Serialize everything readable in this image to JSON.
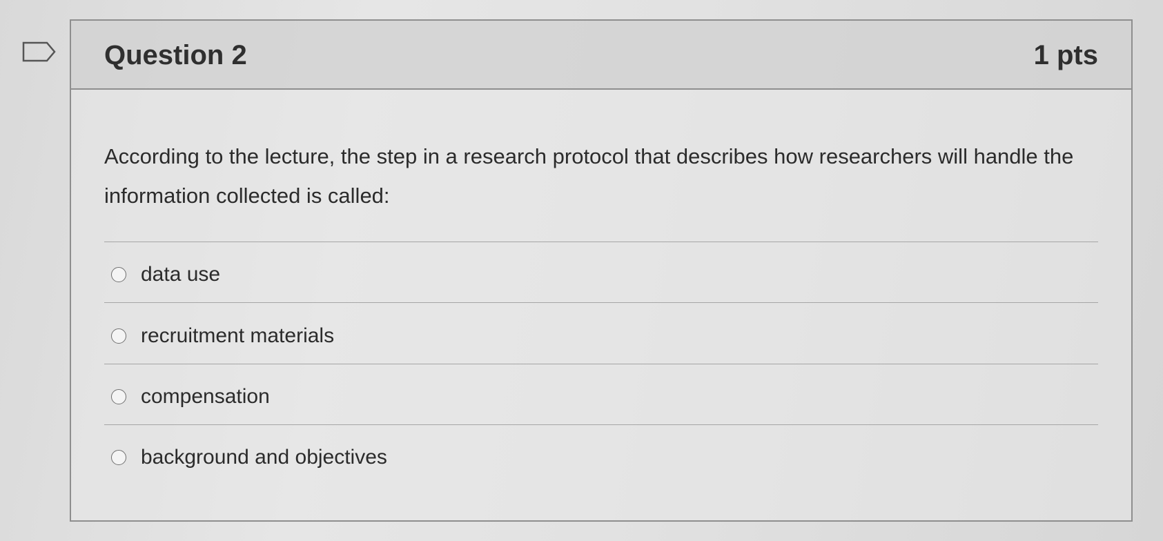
{
  "question": {
    "title": "Question 2",
    "points": "1 pts",
    "text": "According to the lecture, the step in a research protocol that describes how researchers will handle the information collected is called:",
    "flag_icon": "flag-outline-icon",
    "answers": [
      {
        "label": "data use",
        "selected": false
      },
      {
        "label": "recruitment materials",
        "selected": false
      },
      {
        "label": "compensation",
        "selected": false
      },
      {
        "label": "background and objectives",
        "selected": false
      }
    ]
  },
  "colors": {
    "border": "#8e8e8e",
    "text": "#2b2b2b",
    "header_bg": "#c8c8c8"
  }
}
